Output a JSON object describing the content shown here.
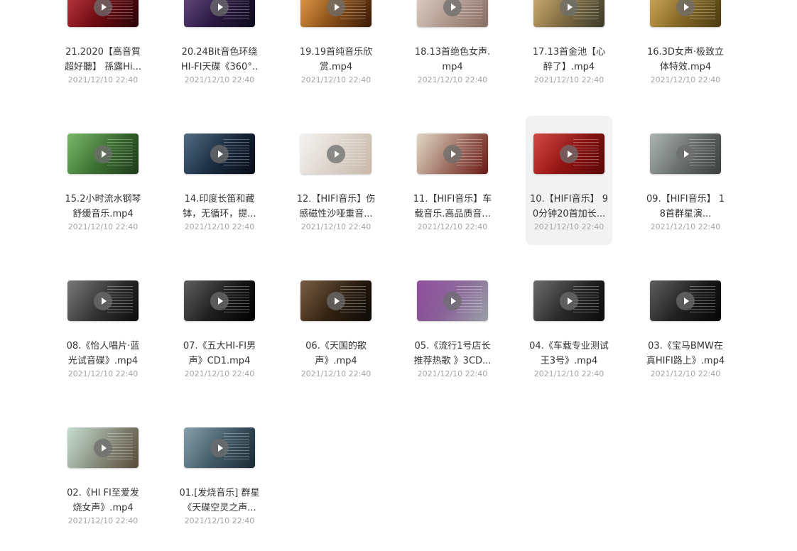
{
  "colors": {
    "name_text": "#333333",
    "date_text": "#a3a3a3",
    "selected_bg": "#f2f2f3",
    "play_badge": "#6e6e6e"
  },
  "files": [
    {
      "name": "21.2020【高音質 超好聽】 孫露Hi...",
      "date": "2021/12/10 22:40",
      "thumb": [
        "#b1121c",
        "#2a0508"
      ]
    },
    {
      "name": "20.24Bit音色环绕 HI-FI天碟《360°..",
      "date": "2021/12/10 22:40",
      "thumb": [
        "#4a2a6a",
        "#0d0a1c"
      ]
    },
    {
      "name": "19.19首纯音乐欣赏.mp4",
      "date": "2021/12/10 22:40",
      "thumb": [
        "#e08a2a",
        "#3a1a08"
      ]
    },
    {
      "name": "18.13首绝色女声.mp4",
      "date": "2021/12/10 22:40",
      "thumb": [
        "#d9c7bb",
        "#8a6e64"
      ]
    },
    {
      "name": "17.13首金池【心醉了】.mp4",
      "date": "2021/12/10 22:40",
      "thumb": [
        "#c8a05a",
        "#3a3a2a"
      ]
    },
    {
      "name": "16.3D女声·极致立体特效.mp4",
      "date": "2021/12/10 22:40",
      "thumb": [
        "#c79a3c",
        "#4a3a10"
      ]
    },
    {
      "name": "15.2小时流水钢琴舒缓音乐.mp4",
      "date": "2021/12/10 22:40",
      "thumb": [
        "#5aa648",
        "#1e3a1a"
      ]
    },
    {
      "name": "14.印度长笛和藏钵，无循环，提...",
      "date": "2021/12/10 22:40",
      "thumb": [
        "#2a4a66",
        "#080c18"
      ]
    },
    {
      "name": "12.【HIFI音乐】伤感磁性沙哑重音...",
      "date": "2021/12/10 22:40",
      "thumb": [
        "#f2f0ee",
        "#c8b8a8"
      ]
    },
    {
      "name": "11.【HIFI音乐】车载音乐.高品质音...",
      "date": "2021/12/10 22:40",
      "thumb": [
        "#d8ccb6",
        "#6a1a14"
      ]
    },
    {
      "name": "10.【HIFI音乐】 90分钟20首加长...",
      "date": "2021/12/10 22:40",
      "thumb": [
        "#c8201c",
        "#5a0808"
      ]
    },
    {
      "name": "09.【HIFI音乐】 18首群星演...",
      "date": "2021/12/10 22:40",
      "thumb": [
        "#9aa2a0",
        "#3a3e3c"
      ]
    },
    {
      "name": "08.《怡人唱片·蓝光试音碟》.mp4",
      "date": "2021/12/10 22:40",
      "thumb": [
        "#5a5a5a",
        "#0c0c0c"
      ]
    },
    {
      "name": "07.《五大HI-FI男声》CD1.mp4",
      "date": "2021/12/10 22:40",
      "thumb": [
        "#3a3a3a",
        "#000000"
      ]
    },
    {
      "name": "06.《天国的歌声》.mp4",
      "date": "2021/12/10 22:40",
      "thumb": [
        "#5a3a1a",
        "#0c0a08"
      ]
    },
    {
      "name": "05.《流行1号店长推荐热歌 》3CD...",
      "date": "2021/12/10 22:40",
      "thumb": [
        "#7a2a8a",
        "#9aa0a8"
      ]
    },
    {
      "name": "04.《车载专业测试王3号》.mp4",
      "date": "2021/12/10 22:40",
      "thumb": [
        "#4a4a4a",
        "#0a0a0a"
      ]
    },
    {
      "name": "03.《宝马BMW在真HIFI路上》.mp4",
      "date": "2021/12/10 22:40",
      "thumb": [
        "#3a3a3a",
        "#050505"
      ]
    },
    {
      "name": "02.《HI FI至爱发烧女声》.mp4",
      "date": "2021/12/10 22:40",
      "thumb": [
        "#b8d4c4",
        "#5a4a3a"
      ]
    },
    {
      "name": "01.[发烧音乐] 群星《天碟空灵之声...",
      "date": "2021/12/10 22:40",
      "thumb": [
        "#6a8a9a",
        "#1a2a34"
      ]
    }
  ]
}
